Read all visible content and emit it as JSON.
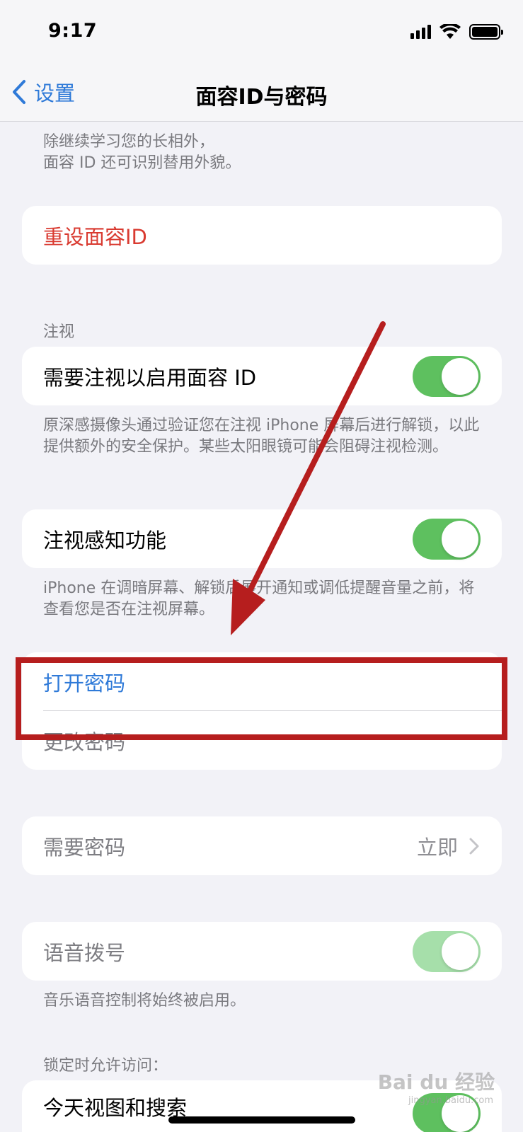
{
  "status": {
    "time": "9:17"
  },
  "nav": {
    "back_label": "设置",
    "title": "面容ID与密码"
  },
  "intro_footer": "除继续学习您的长相外，\n面容 ID 还可识别替用外貌。",
  "reset_face_id": {
    "label": "重设面容ID"
  },
  "attention_section": {
    "header": "注视",
    "require_attention": {
      "label": "需要注视以启用面容 ID",
      "on": true
    },
    "require_attention_footer": "原深感摄像头通过验证您在注视 iPhone 屏幕后进行解锁，以此提供额外的安全保护。某些太阳眼镜可能会阻碍注视检测。",
    "attention_aware": {
      "label": "注视感知功能",
      "on": true
    },
    "attention_aware_footer": "iPhone 在调暗屏幕、解锁后展开通知或调低提醒音量之前，将查看您是否在注视屏幕。"
  },
  "passcode": {
    "turn_on": "打开密码",
    "change": "更改密码"
  },
  "require_passcode": {
    "label": "需要密码",
    "value": "立即"
  },
  "voice_dial": {
    "label": "语音拨号",
    "on": true,
    "footer": "音乐语音控制将始终被启用。"
  },
  "locked_access": {
    "header": "锁定时允许访问：",
    "first_item": "今天视图和搜索"
  },
  "watermark": {
    "main": "Bai du 经验",
    "sub": "jingyan.baidu.com"
  },
  "colors": {
    "accent_blue": "#2f7ad8",
    "destructive_red": "#d93a30",
    "toggle_green": "#5ec05f",
    "annotation_red": "#b61e1e"
  }
}
